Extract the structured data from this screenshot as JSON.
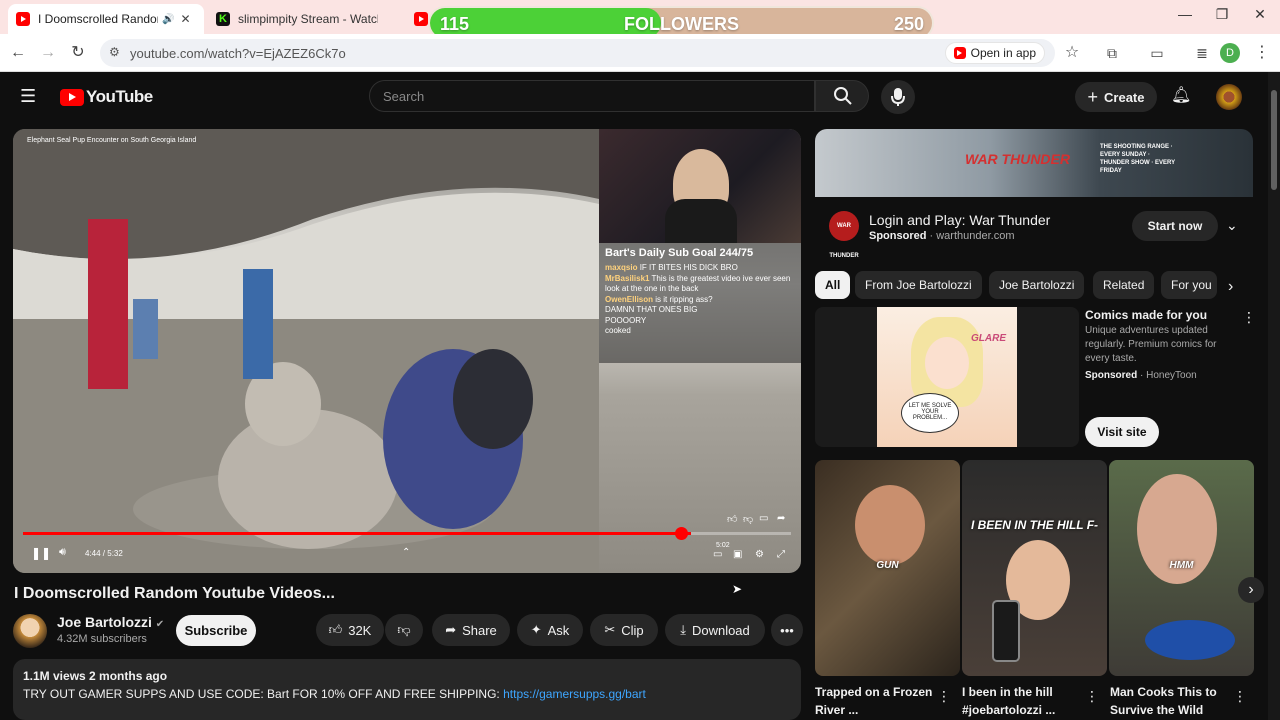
{
  "browser": {
    "tabs": [
      {
        "title": "I Doomscrolled Random Yo",
        "icon": "youtube"
      },
      {
        "title": "slimpimpity Stream - Watch Li",
        "icon": "kick"
      }
    ],
    "url": "youtube.com/watch?v=EjAZEZ6Ck7o",
    "open_in_app": "Open in app",
    "profile_letter": "D"
  },
  "overlay": {
    "current": "115",
    "label": "FOLLOWERS",
    "goal": "250",
    "progress_fraction": 0.46
  },
  "header": {
    "logo": "YouTube",
    "search_placeholder": "Search",
    "create_label": "Create"
  },
  "player": {
    "overlay_caption": "Elephant Seal Pup Encounter on South Georgia Island",
    "time": "4:44 / 5:32",
    "progress_fraction": 0.87,
    "side_time": "5:02",
    "stream": {
      "goal": "Bart's Daily Sub Goal 244/75",
      "chat": [
        {
          "user": "maxqsio",
          "msg": "IF IT BITES HIS DICK BRO"
        },
        {
          "user": "MrBasilisk1",
          "msg": "This is the greatest video ive ever seen"
        },
        {
          "user": "",
          "msg": "look at the one in the back"
        },
        {
          "user": "OwenEllison",
          "msg": "is it ripping ass?"
        },
        {
          "user": "",
          "msg": "DAMNN THAT ONES BIG"
        },
        {
          "user": "",
          "msg": "POOOORY"
        },
        {
          "user": "",
          "msg": "cooked"
        }
      ]
    }
  },
  "video": {
    "title": "I Doomscrolled Random Youtube Videos...",
    "channel": "Joe Bartolozzi",
    "subscribers": "4.32M subscribers",
    "subscribe_label": "Subscribe",
    "likes": "32K",
    "share": "Share",
    "ask": "Ask",
    "clip": "Clip",
    "download": "Download",
    "views_date": "1.1M views  2 months ago",
    "description": "TRY OUT GAMER SUPPS AND USE CODE: Bart FOR 10% OFF AND FREE SHIPPING: ",
    "link": "https://gamersupps.gg/bart"
  },
  "ad": {
    "banner_text": "WAR THUNDER",
    "banner_sub": "THE SHOOTING RANGE · EVERY SUNDAY · THUNDER SHOW · EVERY FRIDAY",
    "logo_text": "WAR THUNDER",
    "title": "Login and Play: War Thunder",
    "sponsored": "Sponsored",
    "domain": "warthunder.com",
    "cta": "Start now"
  },
  "chips": [
    "All",
    "From Joe Bartolozzi",
    "Joe Bartolozzi",
    "Related",
    "For you"
  ],
  "comic_ad": {
    "title": "Comics made for you",
    "description": "Unique adventures updated regularly. Premium comics for every taste.",
    "sponsored": "Sponsored",
    "advertiser": "HoneyToon",
    "cta": "Visit site",
    "panel_glare": "GLARE",
    "panel_bubble": "LET ME SOLVE YOUR PROBLEM..."
  },
  "shorts": [
    {
      "caption": "GUN",
      "title": "Trapped on a Frozen River ..."
    },
    {
      "caption": "I BEEN IN THE HILL F-",
      "title": "I been in the hill #joebartolozzi ..."
    },
    {
      "caption": "HMM",
      "title": "Man Cooks This to Survive the Wild"
    }
  ],
  "colors": {
    "accent": "#ff0000",
    "bg": "#0f0f0f",
    "surface": "#272727",
    "link": "#3ea6ff",
    "followers_fill": "#4cd137"
  }
}
